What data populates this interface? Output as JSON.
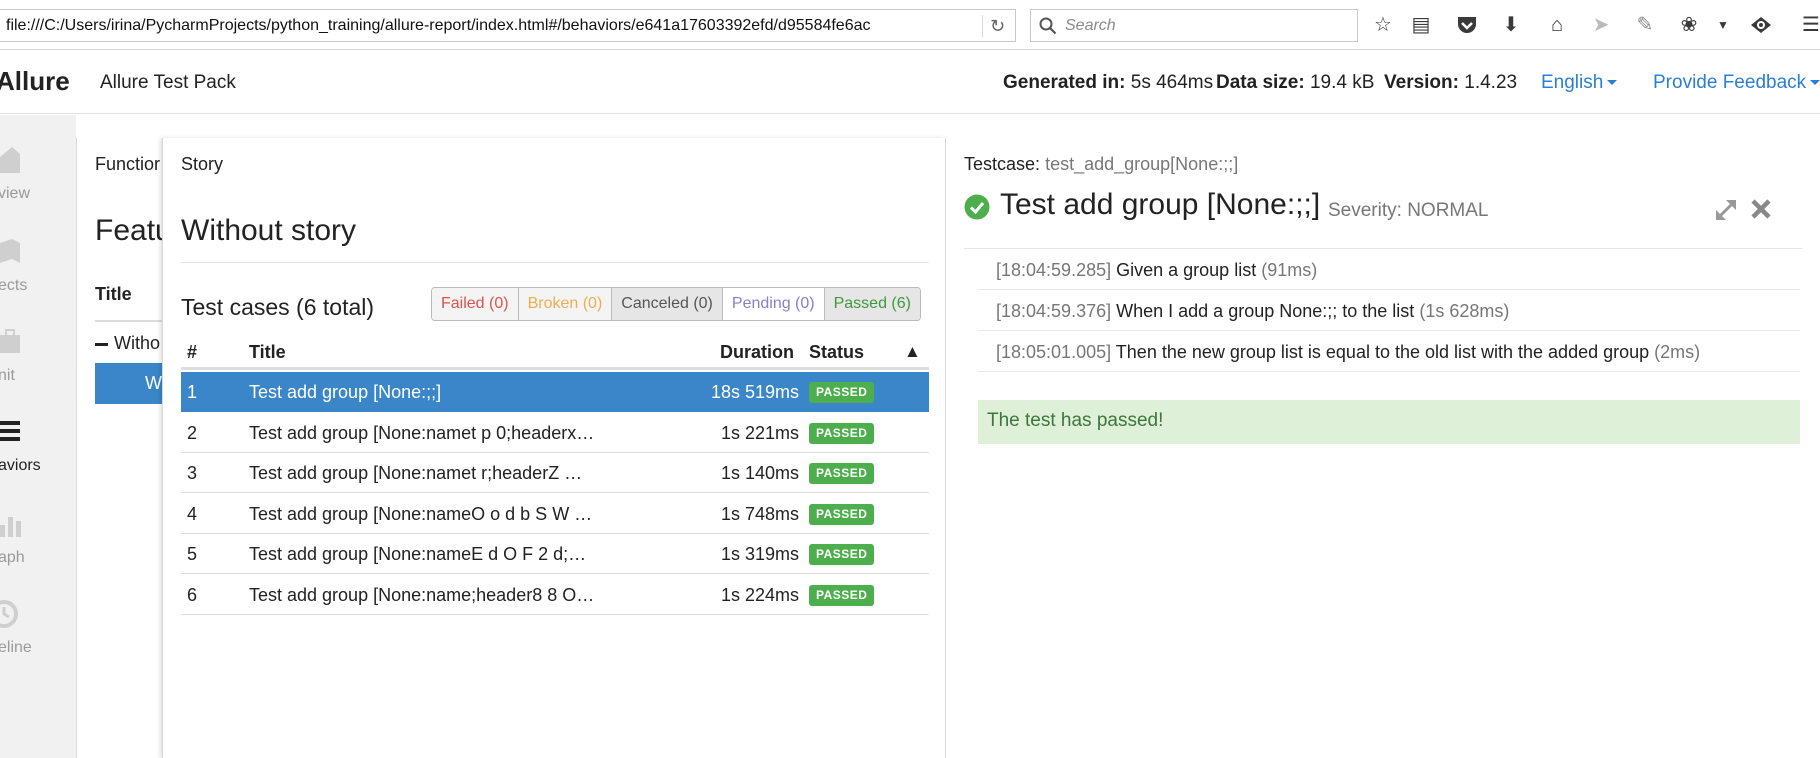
{
  "browser": {
    "url": "file:///C:/Users/irina/PycharmProjects/python_training/allure-report/index.html#/behaviors/e641a17603392efd/d95584fe6ac",
    "search_placeholder": "Search",
    "toolbar_icons": [
      "star-icon",
      "reading-list-icon",
      "pocket-icon",
      "download-icon",
      "home-icon",
      "send-icon",
      "extension-icon",
      "bug-icon",
      "dropdown-icon",
      "eye-icon",
      "menu-icon"
    ]
  },
  "header": {
    "brand": "Allure",
    "pack_name": "Allure Test Pack",
    "generated_label": "Generated in:",
    "generated_value": "5s 464ms",
    "datasize_label": "Data size:",
    "datasize_value": "19.4 kB",
    "version_label": "Version:",
    "version_value": "1.4.23",
    "language": "English",
    "feedback": "Provide Feedback"
  },
  "sidebar": {
    "items": [
      {
        "label": "view",
        "icon": "home-icon"
      },
      {
        "label": "ects",
        "icon": "defects-icon"
      },
      {
        "label": "nit",
        "icon": "xunit-icon"
      },
      {
        "label": "aviors",
        "icon": "list-icon",
        "active": true
      },
      {
        "label": "aph",
        "icon": "graph-icon"
      },
      {
        "label": "eline",
        "icon": "timeline-icon"
      }
    ]
  },
  "features_pane": {
    "crumb": "Functior",
    "title": "Featu",
    "col_title": "Title",
    "group_label": "Witho",
    "row_label": "W"
  },
  "story_pane": {
    "crumb": "Story",
    "title": "Without story",
    "testcases_title": "Test cases (6 total)",
    "filters": [
      {
        "label": "Failed (0)",
        "color": "#d9534f",
        "bg": "#f4f4f4"
      },
      {
        "label": "Broken (0)",
        "color": "#f0ad4e",
        "bg": "#f4f4f4"
      },
      {
        "label": "Canceled (0)",
        "color": "#555555",
        "bg": "#e6e6e6"
      },
      {
        "label": "Pending (0)",
        "color": "#8a7fc7",
        "bg": "#ffffff"
      },
      {
        "label": "Passed (6)",
        "color": "#3c9a3c",
        "bg": "#e6e6e6"
      }
    ],
    "columns": {
      "num": "#",
      "title": "Title",
      "duration": "Duration",
      "status": "Status",
      "sort": "▲"
    },
    "rows": [
      {
        "num": "1",
        "title": "Test add group [None:;;]",
        "duration": "18s 519ms",
        "status": "PASSED",
        "selected": true
      },
      {
        "num": "2",
        "title": "Test add group [None:namet p 0;headerx…",
        "duration": "1s 221ms",
        "status": "PASSED"
      },
      {
        "num": "3",
        "title": "Test add group [None:namet r;headerZ …",
        "duration": "1s 140ms",
        "status": "PASSED"
      },
      {
        "num": "4",
        "title": "Test add group [None:nameO o d b S W …",
        "duration": "1s 748ms",
        "status": "PASSED"
      },
      {
        "num": "5",
        "title": "Test add group [None:nameE d O F 2 d;…",
        "duration": "1s 319ms",
        "status": "PASSED"
      },
      {
        "num": "6",
        "title": "Test add group [None:name;header8 8 O…",
        "duration": "1s 224ms",
        "status": "PASSED"
      }
    ]
  },
  "testcase_pane": {
    "crumb_label": "Testcase:",
    "crumb_value": "test_add_group[None:;;]",
    "title": "Test add group [None:;;]",
    "severity": "Severity: NORMAL",
    "steps": [
      {
        "time": "[18:04:59.285]",
        "text": "Given a group list",
        "duration": "(91ms)"
      },
      {
        "time": "[18:04:59.376]",
        "text": "When I add a group None:;; to the list",
        "duration": "(1s 628ms)"
      },
      {
        "time": "[18:05:01.005]",
        "text": "Then the new group list is equal to the old list with the added group",
        "duration": "(2ms)"
      }
    ],
    "result_message": "The test has passed!"
  },
  "colors": {
    "accent": "#3b86c8",
    "passed": "#4cae4c",
    "link": "#2a7fd4"
  }
}
